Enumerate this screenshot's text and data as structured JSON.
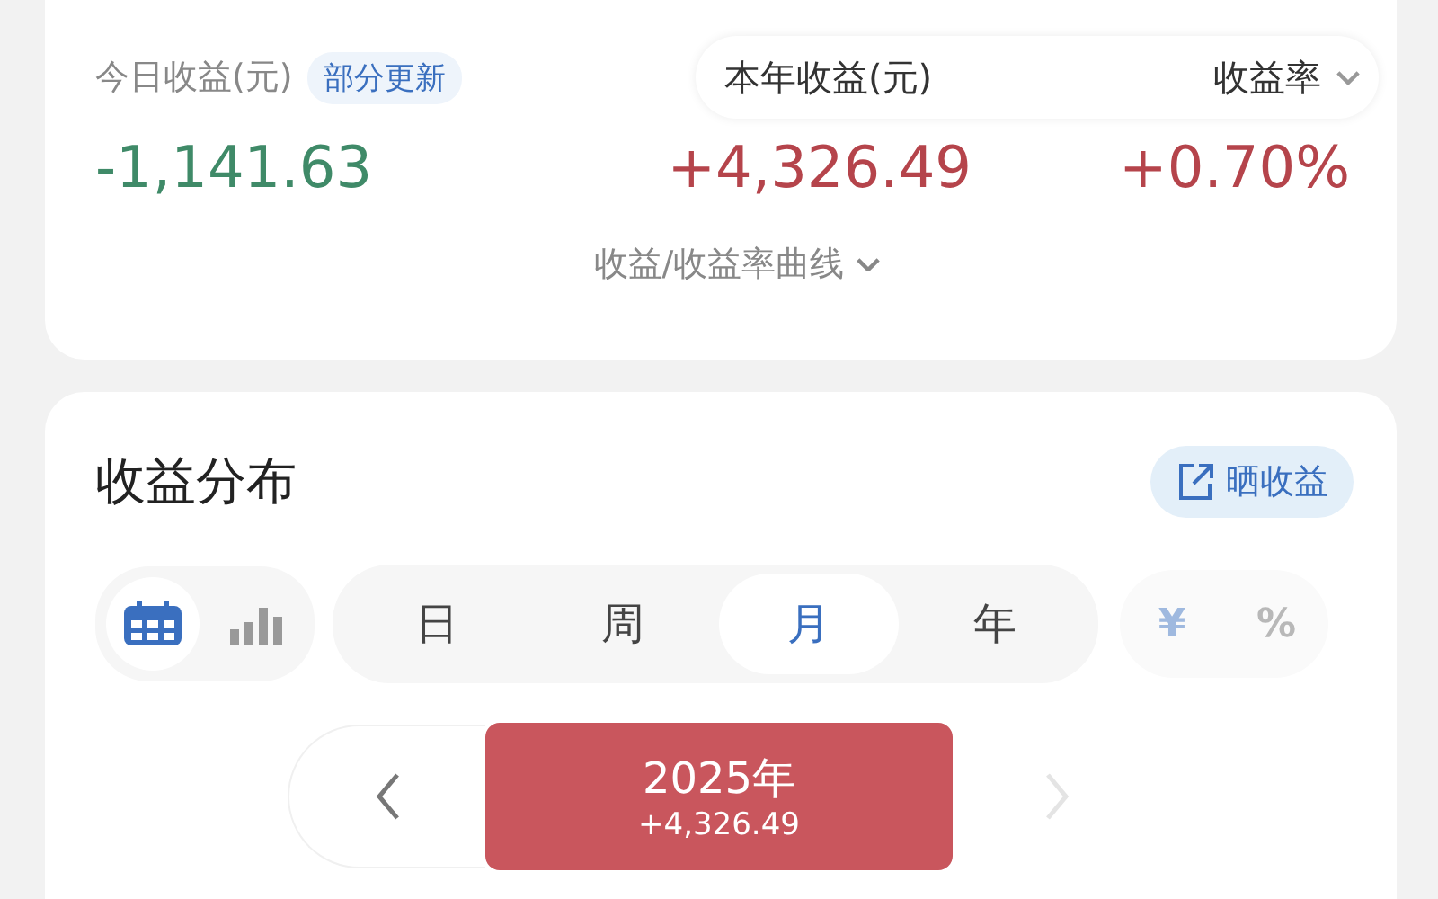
{
  "summary": {
    "today": {
      "label": "今日收益(元)",
      "badge": "部分更新",
      "value": "-1,141.63"
    },
    "year": {
      "label": "本年收益(元)",
      "value": "+4,326.49"
    },
    "rate": {
      "label": "收益率",
      "value": "+0.70%"
    },
    "curve_toggle": "收益/收益率曲线"
  },
  "distribution": {
    "title": "收益分布",
    "share_button": "晒收益",
    "view_modes": [
      {
        "kind": "calendar",
        "selected": true
      },
      {
        "kind": "bars",
        "selected": false
      }
    ],
    "periods": [
      {
        "label": "日",
        "selected": false
      },
      {
        "label": "周",
        "selected": false
      },
      {
        "label": "月",
        "selected": true
      },
      {
        "label": "年",
        "selected": false
      }
    ],
    "units": [
      {
        "label": "¥",
        "selected": true
      },
      {
        "label": "%",
        "selected": false
      }
    ],
    "year_nav": {
      "prev_disabled": false,
      "next_disabled": true,
      "label": "2025年",
      "value": "+4,326.49"
    }
  }
}
